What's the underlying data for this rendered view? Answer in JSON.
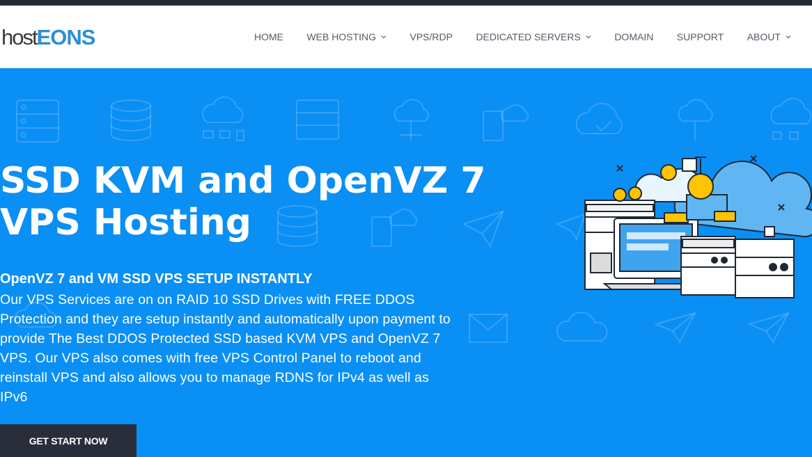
{
  "logo": {
    "part1": "host",
    "part2": "EONS"
  },
  "nav": {
    "items": [
      {
        "label": "HOME",
        "dropdown": false
      },
      {
        "label": "WEB HOSTING",
        "dropdown": true
      },
      {
        "label": "VPS/RDP",
        "dropdown": false
      },
      {
        "label": "DEDICATED SERVERS",
        "dropdown": true
      },
      {
        "label": "DOMAIN",
        "dropdown": false
      },
      {
        "label": "SUPPORT",
        "dropdown": false
      },
      {
        "label": "ABOUT",
        "dropdown": true
      }
    ]
  },
  "hero": {
    "title_line1": "SSD KVM and OpenVZ 7",
    "title_line2": "VPS Hosting",
    "subheading": "OpenVZ 7 and VM SSD VPS SETUP INSTANTLY",
    "paragraph": "Our VPS Services are on on RAID 10 SSD Drives with FREE DDOS Protection and they are setup instantly and automatically upon payment to provide The Best DDOS Protected SSD based KVM VPS and OpenVZ 7 VPS. Our VPS also comes with free VPS Control Panel to reboot and reinstall VPS and also allows you to manage RDNS for IPv4 as well as IPv6",
    "cta_label": "GET START NOW"
  },
  "colors": {
    "top_strip": "#262a36",
    "nav_bg": "#ffffff",
    "nav_text": "#555b66",
    "hero_bg": "#0a8ff5",
    "logo_host": "#3a3a3a",
    "logo_eons": "#2b8fd6",
    "cta_bg": "#2a2e3a",
    "illustration_accent": "#ffc300"
  },
  "icons": {
    "chevron": "chevron-down-icon",
    "background_pattern": [
      "server-rack-icon",
      "database-icon",
      "cloud-network-icon",
      "cloud-check-icon",
      "paper-plane-icon",
      "envelope-icon",
      "cloud-icon",
      "clipboard-icon"
    ],
    "hero_illustration": "server-cloud-illustration"
  }
}
